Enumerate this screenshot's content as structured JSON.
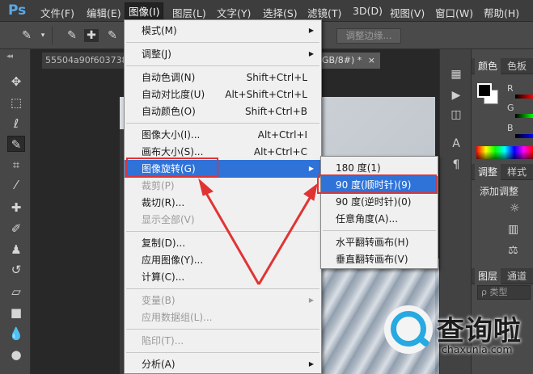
{
  "app": {
    "logo": "Ps"
  },
  "menubar": {
    "items": [
      "文件(F)",
      "编辑(E)",
      "图像(I)",
      "图层(L)",
      "文字(Y)",
      "选择(S)",
      "滤镜(T)",
      "3D(D)",
      "视图(V)",
      "窗口(W)",
      "帮助(H)"
    ],
    "active": "图像(I)"
  },
  "options_bar": {
    "refine_edge_label": "调整边缘..."
  },
  "document": {
    "tab1_title": "55504a90f603738",
    "tab2_title": "GB/8#) *",
    "tab2_close": "×"
  },
  "image_menu": {
    "items": [
      {
        "label": "模式(M)",
        "shortcut": "",
        "submenu": true,
        "disabled": false
      },
      {
        "label": "调整(J)",
        "shortcut": "",
        "submenu": true,
        "disabled": false
      },
      {
        "label": "自动色调(N)",
        "shortcut": "Shift+Ctrl+L",
        "submenu": false,
        "disabled": false
      },
      {
        "label": "自动对比度(U)",
        "shortcut": "Alt+Shift+Ctrl+L",
        "submenu": false,
        "disabled": false
      },
      {
        "label": "自动颜色(O)",
        "shortcut": "Shift+Ctrl+B",
        "submenu": false,
        "disabled": false
      },
      {
        "label": "图像大小(I)...",
        "shortcut": "Alt+Ctrl+I",
        "submenu": false,
        "disabled": false
      },
      {
        "label": "画布大小(S)...",
        "shortcut": "Alt+Ctrl+C",
        "submenu": false,
        "disabled": false
      },
      {
        "label": "图像旋转(G)",
        "shortcut": "",
        "submenu": true,
        "disabled": false,
        "highlighted": true
      },
      {
        "label": "裁剪(P)",
        "shortcut": "",
        "submenu": false,
        "disabled": true
      },
      {
        "label": "裁切(R)...",
        "shortcut": "",
        "submenu": false,
        "disabled": false
      },
      {
        "label": "显示全部(V)",
        "shortcut": "",
        "submenu": false,
        "disabled": true
      },
      {
        "label": "复制(D)...",
        "shortcut": "",
        "submenu": false,
        "disabled": false
      },
      {
        "label": "应用图像(Y)...",
        "shortcut": "",
        "submenu": false,
        "disabled": false
      },
      {
        "label": "计算(C)...",
        "shortcut": "",
        "submenu": false,
        "disabled": false
      },
      {
        "label": "变量(B)",
        "shortcut": "",
        "submenu": true,
        "disabled": true
      },
      {
        "label": "应用数据组(L)...",
        "shortcut": "",
        "submenu": false,
        "disabled": true
      },
      {
        "label": "陷印(T)...",
        "shortcut": "",
        "submenu": false,
        "disabled": true
      },
      {
        "label": "分析(A)",
        "shortcut": "",
        "submenu": true,
        "disabled": false
      }
    ]
  },
  "rotate_submenu": {
    "items": [
      {
        "label": "180 度(1)",
        "highlighted": false
      },
      {
        "label": "90 度(顺时针)(9)",
        "highlighted": true
      },
      {
        "label": "90 度(逆时针)(0)",
        "highlighted": false
      },
      {
        "label": "任意角度(A)...",
        "highlighted": false
      },
      {
        "label": "水平翻转画布(H)",
        "highlighted": false
      },
      {
        "label": "垂直翻转画布(V)",
        "highlighted": false
      }
    ]
  },
  "color_panel": {
    "tabs": [
      "颜色",
      "色板"
    ],
    "channels": [
      "R",
      "G",
      "B"
    ],
    "foreground": "#000000",
    "background": "#ffffff"
  },
  "adjustments_panel": {
    "tabs": [
      "调整",
      "样式"
    ],
    "title": "添加调整"
  },
  "layers_panel": {
    "tabs": [
      "图层",
      "通道"
    ],
    "search_placeholder": "ρ 类型"
  },
  "watermark": {
    "text": "查询啦",
    "url": "chaxunla.com"
  },
  "colors": {
    "menu_highlight": "#2f73d9",
    "annotation_red": "#e03434",
    "logo_blue": "#27a9e1"
  }
}
